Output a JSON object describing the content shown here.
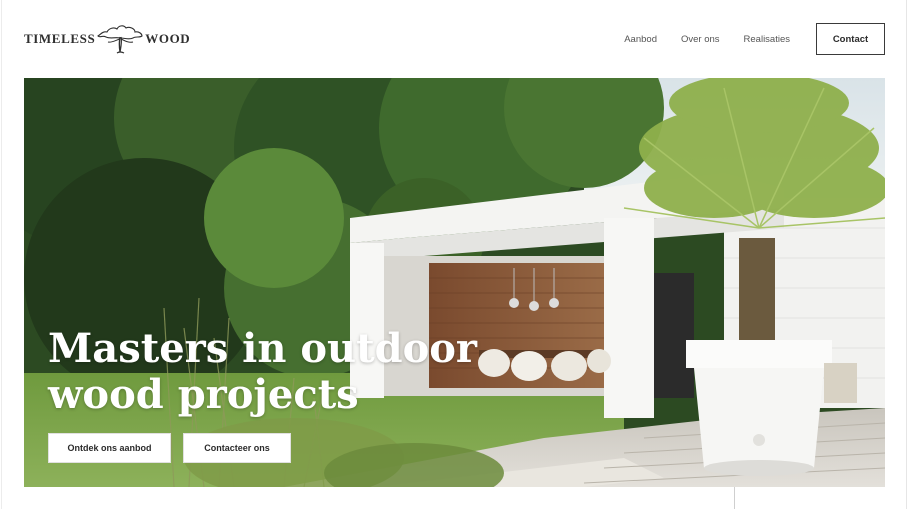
{
  "brand": {
    "word_left": "TIMELESS",
    "word_right": "WOOD",
    "logo_icon": "tree-logo-icon"
  },
  "nav": {
    "items": [
      {
        "label": "Aanbod"
      },
      {
        "label": "Over ons"
      },
      {
        "label": "Realisaties"
      }
    ],
    "contact_label": "Contact"
  },
  "hero": {
    "title_line_1": "Masters in outdoor",
    "title_line_2": "wood projects",
    "cta_primary": "Ontdek ons aanbod",
    "cta_secondary": "Contacteer ons",
    "image_subject": "garden-pavilion-photo"
  },
  "colors": {
    "text": "#2b2b2b",
    "hero_text": "#ffffff",
    "button_bg": "#ffffff",
    "foliage": "#2f4d24",
    "wood": "#8a5a3a"
  }
}
